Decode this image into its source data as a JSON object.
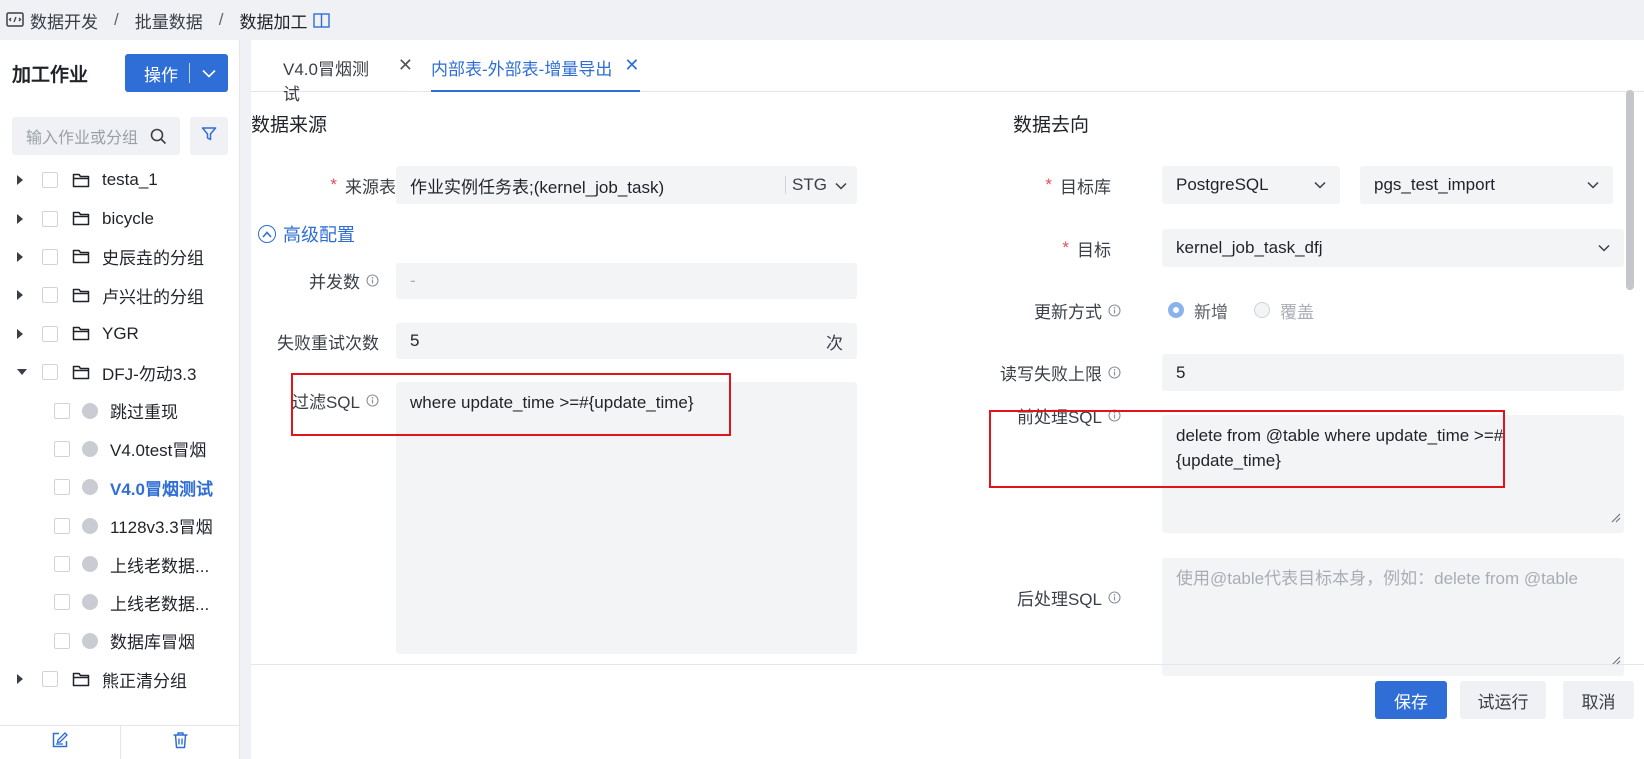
{
  "breadcrumb": {
    "items": [
      {
        "label": "数据开发"
      },
      {
        "label": "批量数据"
      },
      {
        "label": "数据加工"
      }
    ],
    "separator": "/"
  },
  "sidebar": {
    "title": "加工作业",
    "operate_label": "操作",
    "search_placeholder": "输入作业或分组",
    "tree": [
      {
        "label": "testa_1",
        "type": "folder",
        "expanded": false
      },
      {
        "label": "bicycle",
        "type": "folder",
        "expanded": false
      },
      {
        "label": "史辰垚的分组",
        "type": "folder",
        "expanded": false
      },
      {
        "label": "卢兴壮的分组",
        "type": "folder",
        "expanded": false
      },
      {
        "label": "YGR",
        "type": "folder",
        "expanded": false
      },
      {
        "label": "DFJ-勿动3.3",
        "type": "folder",
        "expanded": true
      },
      {
        "label": "跳过重现",
        "type": "job"
      },
      {
        "label": "V4.0test冒烟",
        "type": "job"
      },
      {
        "label": "V4.0冒烟测试",
        "type": "job",
        "active": true
      },
      {
        "label": "1128v3.3冒烟",
        "type": "job"
      },
      {
        "label": "上线老数据...",
        "type": "job"
      },
      {
        "label": "上线老数据...",
        "type": "job"
      },
      {
        "label": "数据库冒烟",
        "type": "job"
      },
      {
        "label": "熊正清分组",
        "type": "folder",
        "expanded": false
      }
    ]
  },
  "tabs": [
    {
      "label": "V4.0冒烟测试",
      "active": false
    },
    {
      "label": "内部表-外部表-增量导出",
      "active": true
    }
  ],
  "source": {
    "title": "数据来源",
    "table_label": "来源表",
    "table_value": "作业实例任务表;(kernel_job_task)",
    "table_schema": "STG",
    "advanced_label": "高级配置",
    "concurrency_label": "并发数",
    "concurrency_value": "-",
    "retry_label": "失败重试次数",
    "retry_value": "5",
    "retry_unit": "次",
    "filter_label": "过滤SQL",
    "filter_value": "where update_time >=#{update_time}"
  },
  "target": {
    "title": "数据去向",
    "db_label": "目标库",
    "db_type": "PostgreSQL",
    "db_name": "pgs_test_import",
    "target_label": "目标",
    "target_value": "kernel_job_task_dfj",
    "update_label": "更新方式",
    "update_options": [
      {
        "label": "新增",
        "checked": true
      },
      {
        "label": "覆盖",
        "checked": false
      }
    ],
    "fail_limit_label": "读写失败上限",
    "fail_limit_value": "5",
    "pre_sql_label": "前处理SQL",
    "pre_sql_value": "delete from @table where update_time >=#{update_time}",
    "post_sql_label": "后处理SQL",
    "post_sql_placeholder": "使用@table代表目标本身，例如：delete from @table"
  },
  "footer": {
    "save_label": "保存",
    "trial_label": "试运行",
    "cancel_label": "取消"
  },
  "colors": {
    "primary": "#2f6ed6",
    "required": "#e34d59",
    "highlight_box": "#e3131b"
  }
}
